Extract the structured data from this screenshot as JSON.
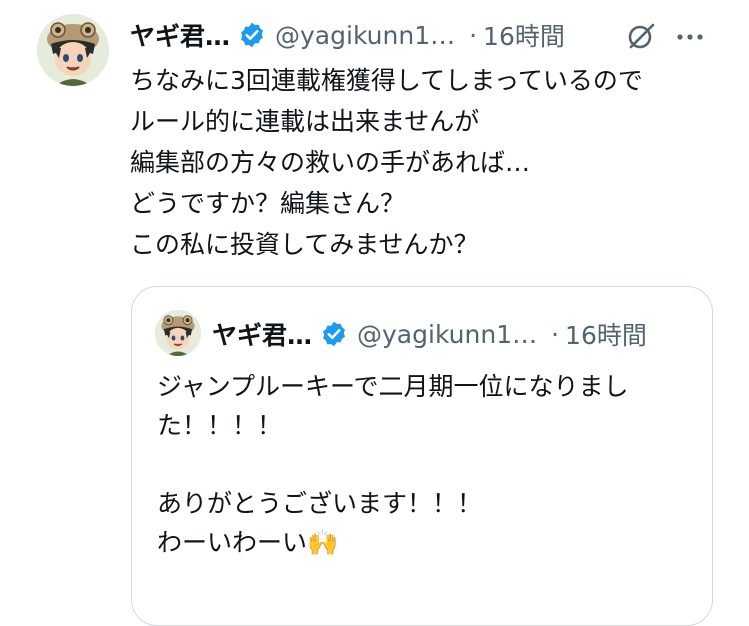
{
  "tweet": {
    "author_name": "ヤギ君…",
    "handle": "@yagikunn1…",
    "separator": "·",
    "time": "16時間",
    "verified_icon": "verified-badge-icon",
    "body": "ちなみに3回連載権獲得してしまっているので\nルール的に連載は出来ませんが\n編集部の方々の救いの手があれば…\nどうですか？編集さん？\nこの私に投資してみませんか？"
  },
  "quoted_tweet": {
    "author_name": "ヤギ君…",
    "handle": "@yagikunn1…",
    "separator": "·",
    "time": "16時間",
    "body": "ジャンプルーキーで二月期一位になりました！！！！\n\nありがとうございます！！！\nわーいわーい🙌"
  },
  "colors": {
    "verified": "#1d9bf0",
    "secondary_text": "#536471",
    "border": "#cfd9de"
  }
}
